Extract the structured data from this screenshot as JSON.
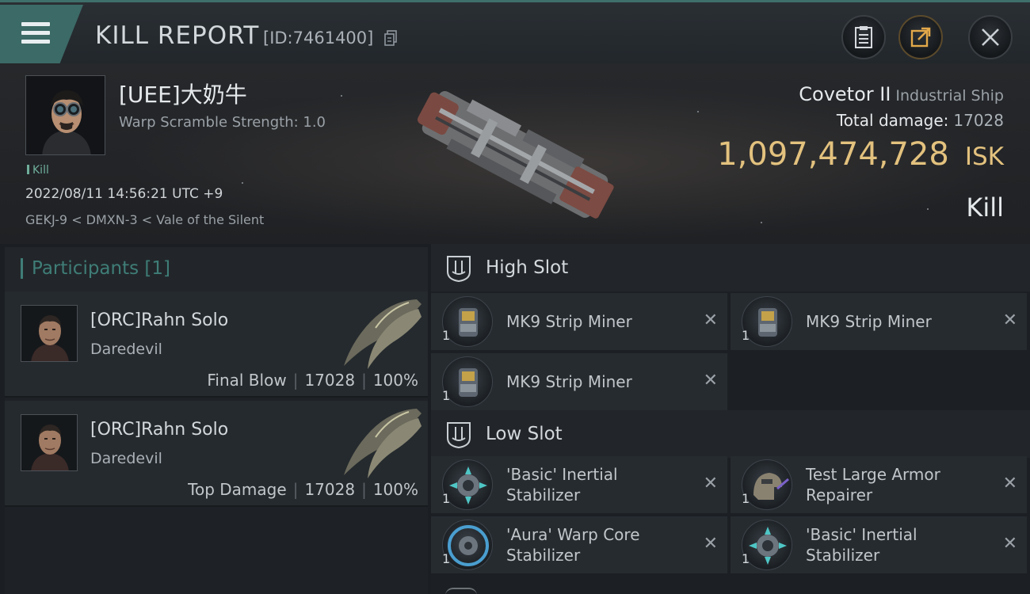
{
  "header": {
    "title": "KILL REPORT",
    "report_id": "[ID:7461400]",
    "icons": [
      "menu-icon",
      "copy-icon",
      "report-icon",
      "share-icon",
      "close-icon"
    ]
  },
  "victim": {
    "name": "[UEE]大奶牛",
    "warp_scramble": "Warp Scramble Strength: 1.0",
    "kill_tag": "Kill",
    "datetime": "2022/08/11 14:56:21 UTC +9",
    "location": "GEKJ-9 < DMXN-3 < Vale of the Silent",
    "ship_name": "Covetor II",
    "ship_class": "Industrial Ship",
    "total_damage_label": "Total damage:",
    "total_damage": "17028",
    "isk_value": "1,097,474,728",
    "isk_unit": "ISK",
    "result": "Kill"
  },
  "participants": {
    "title": "Participants [1]",
    "cards": [
      {
        "name": "[ORC]Rahn Solo",
        "ship": "Daredevil",
        "role": "Final Blow",
        "damage": "17028",
        "percent": "100%"
      },
      {
        "name": "[ORC]Rahn Solo",
        "ship": "Daredevil",
        "role": "Top Damage",
        "damage": "17028",
        "percent": "100%"
      }
    ]
  },
  "slots": {
    "high": {
      "label": "High Slot",
      "modules": [
        {
          "name": "MK9 Strip Miner",
          "qty": "1"
        },
        {
          "name": "MK9 Strip Miner",
          "qty": "1"
        },
        {
          "name": "MK9 Strip Miner",
          "qty": "1"
        }
      ]
    },
    "low": {
      "label": "Low Slot",
      "modules": [
        {
          "name_line1": "'Basic' Inertial",
          "name_line2": "Stabilizer",
          "qty": "1"
        },
        {
          "name_line1": "Test Large Armor",
          "name_line2": "Repairer",
          "qty": "1"
        },
        {
          "name_line1": "'Aura' Warp Core",
          "name_line2": "Stabilizer",
          "qty": "1"
        },
        {
          "name_line1": "'Basic' Inertial",
          "name_line2": "Stabilizer",
          "qty": "1"
        }
      ]
    },
    "remove_symbol": "✕"
  },
  "colors": {
    "accent_teal": "#3f7d77",
    "isk_gold": "#e3c27e",
    "background": "#1b1f23"
  }
}
